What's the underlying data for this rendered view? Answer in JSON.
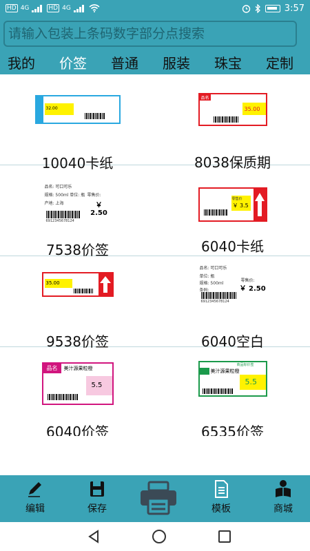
{
  "status": {
    "left_tags": [
      "HD",
      "4G",
      "HD",
      "4G"
    ],
    "time": "3:57"
  },
  "search": {
    "placeholder": "请输入包装上条码数字部分点搜索"
  },
  "tabs": [
    {
      "label": "我的",
      "active": false
    },
    {
      "label": "价签",
      "active": true
    },
    {
      "label": "普通",
      "active": false
    },
    {
      "label": "服装",
      "active": false
    },
    {
      "label": "珠宝",
      "active": false
    },
    {
      "label": "定制",
      "active": false
    }
  ],
  "templates": [
    {
      "name": "10040卡纸"
    },
    {
      "name": "8038保质期"
    },
    {
      "name": "7538价签"
    },
    {
      "name": "6040卡纸"
    },
    {
      "name": "9538价签"
    },
    {
      "name": "6040空白"
    },
    {
      "name": "6040价签"
    },
    {
      "name": "6535价签"
    }
  ],
  "label_text": {
    "t1_price": "32.00",
    "t2_pinming": "品名",
    "t2_price": "35.00",
    "t3_pinming": "品名: 可口可乐",
    "t3_guige": "规格: 500ml 单位: 瓶",
    "t3_chandi": "产地: 上海",
    "t3_lingshou": "零售价:",
    "t3_price": "￥ 2.50",
    "t3_barcode": "6912345678124",
    "t4_price": "￥ 3.5",
    "t4_lingshou": "零售价",
    "t5_price": "35.00",
    "t6_pinming": "品名: 可口可乐",
    "t6_danwei": "单位: 瓶",
    "t6_guige": "规格: 500ml",
    "t6_lingshou": "零售价:",
    "t6_tiaoma": "条码:",
    "t6_price": "￥ 2.50",
    "t6_barcode": "6912345678124",
    "t7_pinming": "品名",
    "t7_product": "美汁源果粒橙",
    "t7_price": "5.5",
    "t8_header": "商品标价签",
    "t8_product": "美汁源果粒橙",
    "t8_price": "5.5"
  },
  "bottom_nav": {
    "edit": "编辑",
    "save": "保存",
    "template": "模板",
    "mall": "商城"
  },
  "colors": {
    "teal": "#3aa3b6",
    "label_yellow": "#fff200",
    "label_red": "#e31b23",
    "label_magenta": "#d1157e",
    "label_green": "#1b9a4b",
    "label_blue": "#29a8e0"
  }
}
